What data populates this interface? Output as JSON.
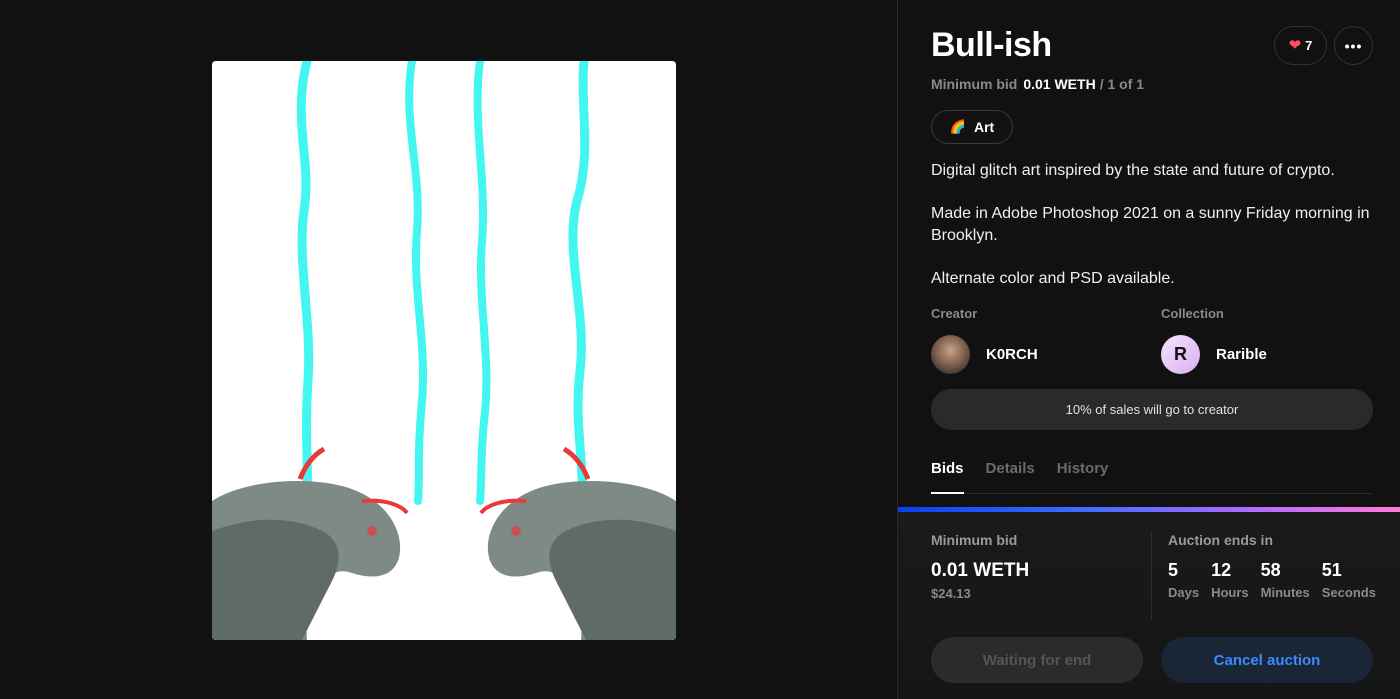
{
  "item": {
    "title": "Bull-ish",
    "likes": "7",
    "more_label": "•••",
    "min_bid_label": "Minimum bid",
    "min_bid_value": "0.01 WETH",
    "edition": "/ 1 of 1",
    "tag_label": "Art",
    "tag_icon": "🌈",
    "description": [
      "Digital glitch art inspired by the state and future of crypto.",
      "Made in Adobe Photoshop 2021 on a sunny Friday morning in Brooklyn.",
      "Alternate color and PSD available."
    ]
  },
  "creator": {
    "label": "Creator",
    "name": "K0RCH"
  },
  "collection": {
    "label": "Collection",
    "name": "Rarible",
    "avatar_letter": "R"
  },
  "royalty_text": "10% of sales will go to creator",
  "tabs": [
    {
      "label": "Bids",
      "active": true
    },
    {
      "label": "Details",
      "active": false
    },
    {
      "label": "History",
      "active": false
    }
  ],
  "bid": {
    "min_bid_label": "Minimum bid",
    "amount": "0.01 WETH",
    "usd": "$24.13",
    "auction_label": "Auction ends in",
    "countdown": [
      {
        "value": "5",
        "unit": "Days"
      },
      {
        "value": "12",
        "unit": "Hours"
      },
      {
        "value": "58",
        "unit": "Minutes"
      },
      {
        "value": "51",
        "unit": "Seconds"
      }
    ]
  },
  "buttons": {
    "waiting": "Waiting for end",
    "cancel": "Cancel auction"
  },
  "icons": {
    "heart": "heart-icon",
    "more": "more-icon",
    "rainbow": "rainbow-icon"
  },
  "colors": {
    "background": "#111111",
    "accent_blue": "#3a8bff",
    "heart": "#ff4d5e",
    "glitch_cyan": "#22f5f0"
  }
}
